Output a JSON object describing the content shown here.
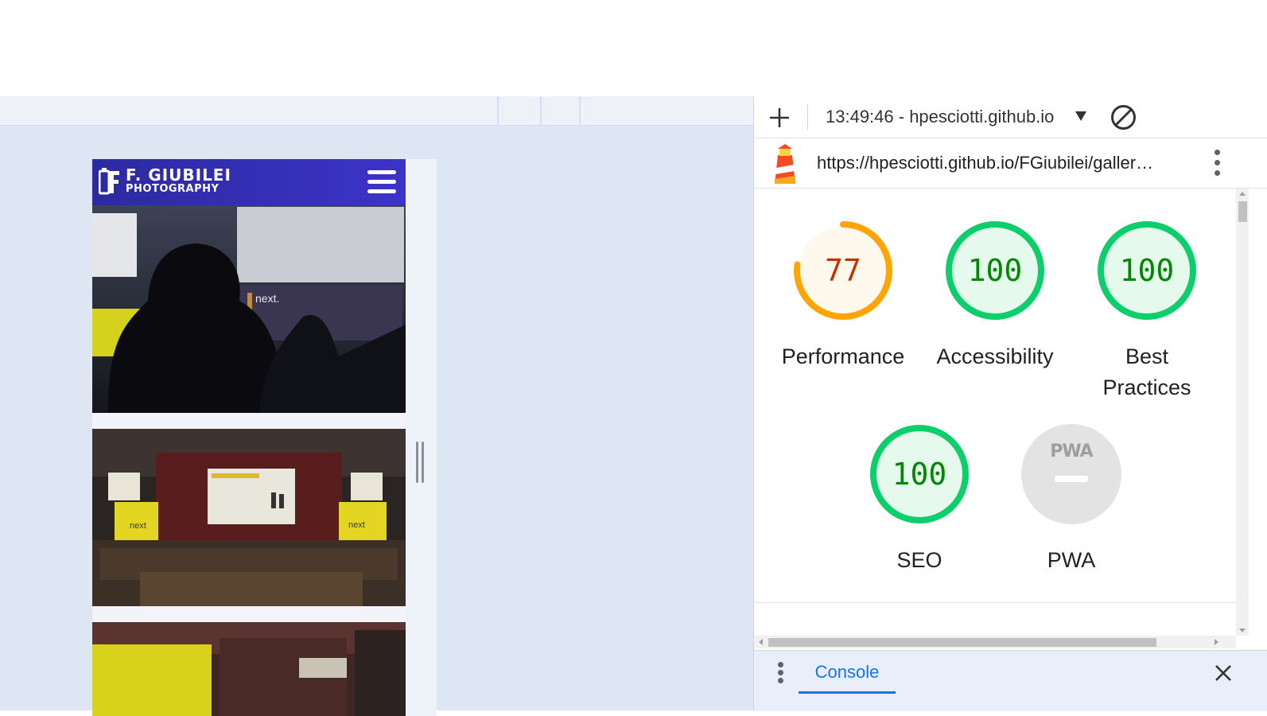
{
  "site": {
    "logo_line1": "F. GIUBILEI",
    "logo_line2": "PHOTOGRAPHY",
    "header_color": "#2f2cb0"
  },
  "devtools": {
    "report_label": "13:49:46 - hpesciotti.github.io",
    "audit_url": "https://hpesciotti.github.io/FGiubilei/galler…",
    "scores": [
      {
        "label": "Performance",
        "value": "77",
        "score": 77,
        "status": "average",
        "color": "#ffa400"
      },
      {
        "label": "Accessibility",
        "value": "100",
        "score": 100,
        "status": "pass",
        "color": "#0cce6b"
      },
      {
        "label": "Best Practices",
        "value": "100",
        "score": 100,
        "status": "pass",
        "color": "#0cce6b"
      },
      {
        "label": "SEO",
        "value": "100",
        "score": 100,
        "status": "pass",
        "color": "#0cce6b"
      },
      {
        "label": "PWA",
        "value": "PWA",
        "score": null,
        "status": "na",
        "color": "#9e9e9e"
      }
    ],
    "drawer_tab": "Console"
  },
  "icons": [
    "plus-icon",
    "caret-down-icon",
    "block-icon",
    "lighthouse-icon",
    "kebab-menu-icon",
    "hamburger-menu-icon",
    "close-icon"
  ]
}
